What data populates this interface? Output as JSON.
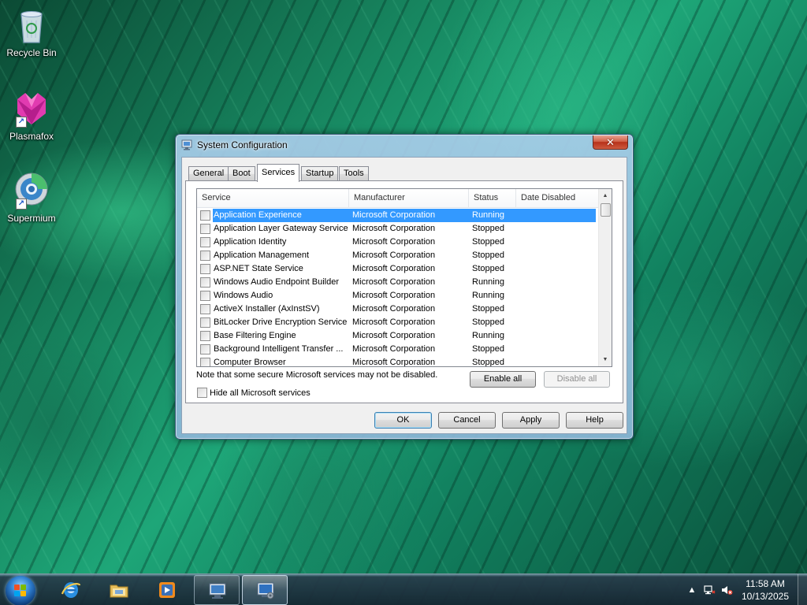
{
  "desktop": {
    "icons": [
      {
        "label": "Recycle Bin",
        "icon": "recycle-bin-icon"
      },
      {
        "label": "Plasmafox",
        "icon": "plasmafox-icon"
      },
      {
        "label": "Supermium",
        "icon": "supermium-icon"
      }
    ]
  },
  "window": {
    "title": "System Configuration",
    "close_label": "✕",
    "tabs": [
      {
        "label": "General"
      },
      {
        "label": "Boot"
      },
      {
        "label": "Services",
        "active": true
      },
      {
        "label": "Startup"
      },
      {
        "label": "Tools"
      }
    ],
    "services": {
      "columns": [
        "Service",
        "Manufacturer",
        "Status",
        "Date Disabled"
      ],
      "rows": [
        {
          "service": "Application Experience",
          "manufacturer": "Microsoft Corporation",
          "status": "Running",
          "date_disabled": "",
          "checked": false,
          "selected": true
        },
        {
          "service": "Application Layer Gateway Service",
          "manufacturer": "Microsoft Corporation",
          "status": "Stopped",
          "date_disabled": "",
          "checked": false
        },
        {
          "service": "Application Identity",
          "manufacturer": "Microsoft Corporation",
          "status": "Stopped",
          "date_disabled": "",
          "checked": false
        },
        {
          "service": "Application Management",
          "manufacturer": "Microsoft Corporation",
          "status": "Stopped",
          "date_disabled": "",
          "checked": false
        },
        {
          "service": "ASP.NET State Service",
          "manufacturer": "Microsoft Corporation",
          "status": "Stopped",
          "date_disabled": "",
          "checked": false
        },
        {
          "service": "Windows Audio Endpoint Builder",
          "manufacturer": "Microsoft Corporation",
          "status": "Running",
          "date_disabled": "",
          "checked": false
        },
        {
          "service": "Windows Audio",
          "manufacturer": "Microsoft Corporation",
          "status": "Running",
          "date_disabled": "",
          "checked": false
        },
        {
          "service": "ActiveX Installer (AxInstSV)",
          "manufacturer": "Microsoft Corporation",
          "status": "Stopped",
          "date_disabled": "",
          "checked": false
        },
        {
          "service": "BitLocker Drive Encryption Service",
          "manufacturer": "Microsoft Corporation",
          "status": "Stopped",
          "date_disabled": "",
          "checked": false
        },
        {
          "service": "Base Filtering Engine",
          "manufacturer": "Microsoft Corporation",
          "status": "Running",
          "date_disabled": "",
          "checked": false
        },
        {
          "service": "Background Intelligent Transfer ...",
          "manufacturer": "Microsoft Corporation",
          "status": "Stopped",
          "date_disabled": "",
          "checked": false
        },
        {
          "service": "Computer Browser",
          "manufacturer": "Microsoft Corporation",
          "status": "Stopped",
          "date_disabled": "",
          "checked": false
        }
      ],
      "note": "Note that some secure Microsoft services may not be disabled.",
      "enable_all": "Enable all",
      "disable_all": "Disable all",
      "hide_ms_label": "Hide all Microsoft services",
      "hide_ms_checked": false
    },
    "buttons": {
      "ok": "OK",
      "cancel": "Cancel",
      "apply": "Apply",
      "help": "Help"
    }
  },
  "taskbar": {
    "items": [
      {
        "name": "internet-explorer",
        "icon": "internet-explorer-icon",
        "state": "pinned"
      },
      {
        "name": "file-explorer",
        "icon": "folder-icon",
        "state": "pinned"
      },
      {
        "name": "media-player",
        "icon": "media-player-icon",
        "state": "pinned"
      },
      {
        "name": "remote-desktop",
        "icon": "remote-desktop-icon",
        "state": "running"
      },
      {
        "name": "system-configuration",
        "icon": "system-configuration-icon",
        "state": "active"
      }
    ],
    "tray": {
      "icons": [
        "show-hidden-icons-icon",
        "network-icon",
        "volume-muted-icon"
      ],
      "time": "11:58 AM",
      "date": "10/13/2025"
    }
  },
  "colors": {
    "selection": "#3399ff",
    "close_button": "#c7472e",
    "wallpaper_green": "#1ea678"
  }
}
